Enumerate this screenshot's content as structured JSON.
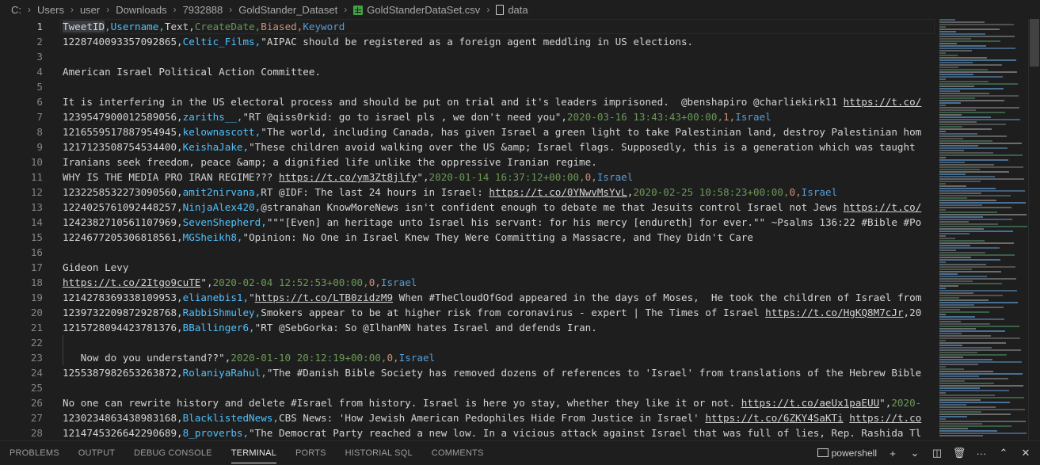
{
  "breadcrumb": [
    "C:",
    "Users",
    "user",
    "Downloads",
    "7932888",
    "GoldStander_Dataset",
    "GoldStanderDataSet.csv",
    "data"
  ],
  "editor": {
    "active_line": 1,
    "lines": [
      {
        "n": "1",
        "segs": [
          [
            "c-id",
            "TweetID"
          ],
          [
            "c-user",
            ",Username,"
          ],
          [
            "c-text",
            "Text,"
          ],
          [
            "c-date",
            "CreateDate,"
          ],
          [
            "c-bias",
            "Biased,"
          ],
          [
            "c-kw",
            "Keyword"
          ]
        ]
      },
      {
        "n": "2",
        "segs": [
          [
            "c-id",
            "1228740093357092865,"
          ],
          [
            "c-user",
            "Celtic_Films,"
          ],
          [
            "c-text",
            "\"AIPAC should be registered as a foreign agent meddling in US elections."
          ]
        ]
      },
      {
        "n": "3",
        "segs": []
      },
      {
        "n": "4",
        "segs": [
          [
            "c-text",
            "American Israel Political Action Committee."
          ]
        ]
      },
      {
        "n": "5",
        "segs": []
      },
      {
        "n": "6",
        "segs": [
          [
            "c-text",
            "It is interfering in the US electoral process and should be put on trial and it's leaders imprisoned.  @benshapiro @charliekirk11 "
          ],
          [
            "c-text c-link",
            "https://t.co/"
          ]
        ]
      },
      {
        "n": "7",
        "segs": [
          [
            "c-id",
            "1239547900012589056,"
          ],
          [
            "c-user",
            "zariths__,"
          ],
          [
            "c-text",
            "\"RT @qiss0rkid: go to israel pls , we don't need you\","
          ],
          [
            "c-date",
            "2020-03-16 13:43:43+00:00,"
          ],
          [
            "c-bias",
            "1,"
          ],
          [
            "c-kw",
            "Israel"
          ]
        ]
      },
      {
        "n": "8",
        "segs": [
          [
            "c-id",
            "1216559517887954945,"
          ],
          [
            "c-user",
            "kelownascott,"
          ],
          [
            "c-text",
            "\"The world, including Canada, has given Israel a green light to take Palestinian land, destroy Palestinian hom"
          ]
        ]
      },
      {
        "n": "9",
        "segs": [
          [
            "c-id",
            "1217123508754534400,"
          ],
          [
            "c-user",
            "KeishaJake,"
          ],
          [
            "c-text",
            "\"These children avoid walking over the US &amp; Israel flags. Supposedly, this is a generation which was taught"
          ]
        ]
      },
      {
        "n": "10",
        "segs": [
          [
            "c-text",
            "Iranians seek freedom, peace &amp; a dignified life unlike the oppressive Iranian regime."
          ]
        ]
      },
      {
        "n": "11",
        "segs": [
          [
            "c-text",
            "WHY IS THE MEDIA PRO IRAN REGIME??? "
          ],
          [
            "c-text c-link",
            "https://t.co/ym3Zt8jlfy"
          ],
          [
            "c-text",
            "\","
          ],
          [
            "c-date",
            "2020-01-14 16:37:12+00:00,"
          ],
          [
            "c-bias",
            "0,"
          ],
          [
            "c-kw",
            "Israel"
          ]
        ]
      },
      {
        "n": "12",
        "segs": [
          [
            "c-id",
            "1232258532273090560,"
          ],
          [
            "c-user",
            "amit2nirvana,"
          ],
          [
            "c-text",
            "RT @IDF: The last 24 hours in Israel: "
          ],
          [
            "c-text c-link",
            "https://t.co/0YNwvMsYvL"
          ],
          [
            "c-text",
            ","
          ],
          [
            "c-date",
            "2020-02-25 10:58:23+00:00,"
          ],
          [
            "c-bias",
            "0,"
          ],
          [
            "c-kw",
            "Israel"
          ]
        ]
      },
      {
        "n": "13",
        "segs": [
          [
            "c-id",
            "1224025761092448257,"
          ],
          [
            "c-user",
            "NinjaAlex420,"
          ],
          [
            "c-text",
            "@stranahan KnowMoreNews isn't confident enough to debate me that Jesuits control Israel not Jews "
          ],
          [
            "c-text c-link",
            "https://t.co/"
          ]
        ]
      },
      {
        "n": "14",
        "segs": [
          [
            "c-id",
            "1242382710561107969,"
          ],
          [
            "c-user",
            "SevenShepherd,"
          ],
          [
            "c-text",
            "\"\"\"[Even] an heritage unto Israel his servant: for his mercy [endureth] for ever.\"\" ~Psalms 136:22 #Bible #Po"
          ]
        ]
      },
      {
        "n": "15",
        "segs": [
          [
            "c-id",
            "1224677205306818561,"
          ],
          [
            "c-user",
            "MGSheikh8,"
          ],
          [
            "c-text",
            "\"Opinion: No One in Israel Knew They Were Committing a Massacre, and They Didn't Care"
          ]
        ]
      },
      {
        "n": "16",
        "segs": []
      },
      {
        "n": "17",
        "segs": [
          [
            "c-text",
            "Gideon Levy"
          ]
        ]
      },
      {
        "n": "18",
        "segs": [
          [
            "c-text c-link",
            "https://t.co/2Itgo9cuTE"
          ],
          [
            "c-text",
            "\","
          ],
          [
            "c-date",
            "2020-02-04 12:52:53+00:00,"
          ],
          [
            "c-bias",
            "0,"
          ],
          [
            "c-kw",
            "Israel"
          ]
        ]
      },
      {
        "n": "19",
        "segs": [
          [
            "c-id",
            "1214278369338109953,"
          ],
          [
            "c-user",
            "elianebis1,"
          ],
          [
            "c-text",
            "\""
          ],
          [
            "c-text c-link",
            "https://t.co/LTB0zidzM9"
          ],
          [
            "c-text",
            " When #TheCloudOfGod appeared in the days of Moses,  He took the children of Israel from"
          ]
        ]
      },
      {
        "n": "20",
        "segs": [
          [
            "c-id",
            "1239732209872928768,"
          ],
          [
            "c-user",
            "RabbiShmuley,"
          ],
          [
            "c-text",
            "Smokers appear to be at higher risk from coronavirus - expert | The Times of Israel "
          ],
          [
            "c-text c-link",
            "https://t.co/HgKQ8M7cJr"
          ],
          [
            "c-text",
            ",20"
          ]
        ]
      },
      {
        "n": "21",
        "segs": [
          [
            "c-id",
            "1215728094423781376,"
          ],
          [
            "c-user",
            "BBallinger6,"
          ],
          [
            "c-text",
            "\"RT @SebGorka: So @IlhanMN hates Israel and defends Iran."
          ]
        ]
      },
      {
        "n": "22",
        "segs": []
      },
      {
        "n": "23",
        "segs": [
          [
            "c-text",
            "   Now do you understand??\","
          ],
          [
            "c-date",
            "2020-01-10 20:12:19+00:00,"
          ],
          [
            "c-bias",
            "0,"
          ],
          [
            "c-kw",
            "Israel"
          ]
        ]
      },
      {
        "n": "24",
        "segs": [
          [
            "c-id",
            "1255387982653263872,"
          ],
          [
            "c-user",
            "RolaniyaRahul,"
          ],
          [
            "c-text",
            "\"The #Danish Bible Society has removed dozens of references to 'Israel' from translations of the Hebrew Bible"
          ]
        ]
      },
      {
        "n": "25",
        "segs": []
      },
      {
        "n": "26",
        "segs": [
          [
            "c-text",
            "No one can rewrite history and delete #Israel from history. Israel is here yo stay, whether they like it or not. "
          ],
          [
            "c-text c-link",
            "https://t.co/aeUx1paEUU"
          ],
          [
            "c-text",
            "\","
          ],
          [
            "c-date",
            "2020-"
          ]
        ]
      },
      {
        "n": "27",
        "segs": [
          [
            "c-id",
            "1230234863438983168,"
          ],
          [
            "c-user",
            "BlacklistedNews,"
          ],
          [
            "c-text",
            "CBS News: 'How Jewish American Pedophiles Hide From Justice in Israel' "
          ],
          [
            "c-text c-link",
            "https://t.co/6ZKY4SaKTi"
          ],
          [
            "c-text",
            " "
          ],
          [
            "c-text c-link",
            "https://t.co"
          ]
        ]
      },
      {
        "n": "28",
        "segs": [
          [
            "c-id",
            "1214745326642290689,"
          ],
          [
            "c-user",
            "8_proverbs,"
          ],
          [
            "c-text",
            "\"The Democrat Party reached a new low. In a vicious attack against Israel that was full of lies, Rep. Rashida Tl"
          ]
        ]
      }
    ]
  },
  "panel": {
    "tabs": [
      "PROBLEMS",
      "OUTPUT",
      "DEBUG CONSOLE",
      "TERMINAL",
      "PORTS",
      "HISTORIAL SQL",
      "COMMENTS"
    ],
    "active_tab": "TERMINAL",
    "terminal_name": "powershell",
    "icons": [
      "plus-icon",
      "chevron-down-icon",
      "split-icon",
      "trash-icon",
      "more-icon",
      "chevron-up-icon",
      "close-icon"
    ]
  }
}
